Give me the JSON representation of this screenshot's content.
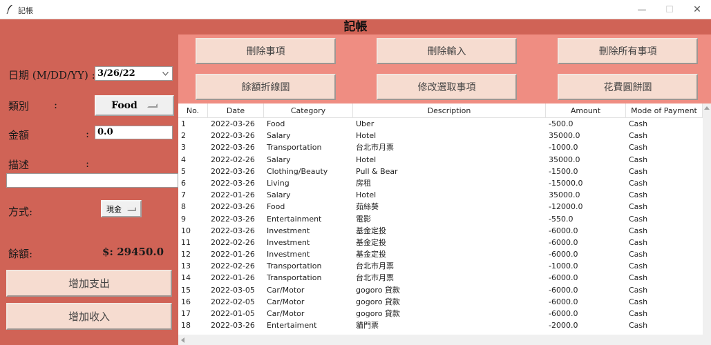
{
  "window": {
    "title": "記帳",
    "controls": {
      "minimize": "—",
      "maximize": "☐",
      "close": "✕"
    }
  },
  "app": {
    "header_title": "記帳",
    "form": {
      "date_label": "日期 (M/DD/YY) :",
      "date_value": "3/26/22",
      "category_label": "類別",
      "category_colon": ":",
      "category_value": "Food",
      "amount_label": "金額",
      "amount_colon": ":",
      "amount_value": "0.0",
      "description_label": "描述",
      "description_colon": ":",
      "description_value": "",
      "method_label": "方式:",
      "method_value": "現金",
      "balance_label": "餘額:",
      "balance_value": "$: 29450.0",
      "add_expense_label": "增加支出",
      "add_income_label": "增加收入"
    },
    "actions": {
      "delete_item": "刪除事項",
      "delete_input": "刪除輸入",
      "delete_all": "刪除所有事項",
      "balance_line_chart": "餘額折線圖",
      "edit_selected": "修改選取事項",
      "expense_pie_chart": "花費圓餅圖"
    },
    "table": {
      "columns": [
        "No.",
        "Date",
        "Category",
        "Description",
        "Amount",
        "Mode of Payment"
      ],
      "rows": [
        [
          "1",
          "2022-03-26",
          "Food",
          "Uber",
          "-500.0",
          "Cash"
        ],
        [
          "2",
          "2022-03-26",
          "Salary",
          "Hotel",
          "35000.0",
          "Cash"
        ],
        [
          "3",
          "2022-03-26",
          "Transportation",
          "台北市月票",
          "-1000.0",
          "Cash"
        ],
        [
          "4",
          "2022-02-26",
          "Salary",
          "Hotel",
          "35000.0",
          "Cash"
        ],
        [
          "5",
          "2022-03-26",
          "Clothing/Beauty",
          "Pull & Bear",
          "-1500.0",
          "Cash"
        ],
        [
          "6",
          "2022-03-26",
          "Living",
          "房租",
          "-15000.0",
          "Cash"
        ],
        [
          "7",
          "2022-01-26",
          "Salary",
          "Hotel",
          "35000.0",
          "Cash"
        ],
        [
          "8",
          "2022-03-26",
          "Food",
          "茹絲葵",
          "-12000.0",
          "Cash"
        ],
        [
          "9",
          "2022-03-26",
          "Entertainment",
          "電影",
          "-550.0",
          "Cash"
        ],
        [
          "10",
          "2022-03-26",
          "Investment",
          "基金定投",
          "-6000.0",
          "Cash"
        ],
        [
          "11",
          "2022-02-26",
          "Investment",
          "基金定投",
          "-6000.0",
          "Cash"
        ],
        [
          "12",
          "2022-01-26",
          "Investment",
          "基金定投",
          "-6000.0",
          "Cash"
        ],
        [
          "13",
          "2022-02-26",
          "Transportation",
          "台北市月票",
          "-1000.0",
          "Cash"
        ],
        [
          "14",
          "2022-01-26",
          "Transportation",
          "台北市月票",
          "-6000.0",
          "Cash"
        ],
        [
          "15",
          "2022-03-05",
          "Car/Motor",
          "gogoro 貸款",
          "-6000.0",
          "Cash"
        ],
        [
          "16",
          "2022-02-05",
          "Car/Motor",
          "gogoro 貸款",
          "-6000.0",
          "Cash"
        ],
        [
          "17",
          "2022-01-05",
          "Car/Motor",
          "gogoro 貸款",
          "-6000.0",
          "Cash"
        ],
        [
          "18",
          "2022-03-26",
          "Entertaiment",
          "貓門票",
          "-2000.0",
          "Cash"
        ]
      ]
    },
    "colors": {
      "left_panel": "#d06356",
      "button_area": "#ef8d82",
      "button_face": "#f6dcd0"
    }
  }
}
